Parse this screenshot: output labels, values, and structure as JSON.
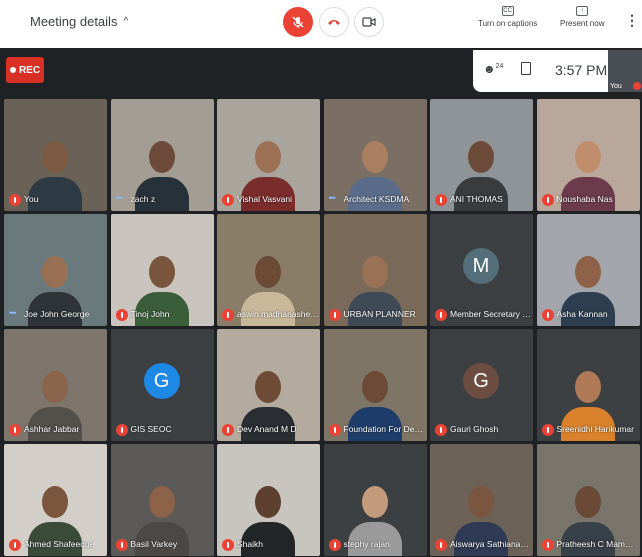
{
  "header": {
    "meeting_details_label": "Meeting details",
    "turn_on_captions_label": "Turn on captions",
    "present_now_label": "Present now",
    "more_label": "⋮",
    "captions_icon": "CC"
  },
  "status": {
    "rec_label": "REC",
    "participant_count": "24",
    "time": "3:57 PM",
    "self_label": "You"
  },
  "tiles": [
    {
      "name": "You",
      "state": "muted",
      "bg": "#6b6257",
      "face": "#7c5a44",
      "shirt": "#2e3a44"
    },
    {
      "name": "zach z",
      "state": "speaking",
      "bg": "#a49d93",
      "face": "#6d4b3b",
      "shirt": "#27313a"
    },
    {
      "name": "Vishal Vasvani",
      "state": "muted",
      "bg": "#a9a59d",
      "face": "#9c7155",
      "shirt": "#7a2c2c"
    },
    {
      "name": "Architect KSDMA",
      "state": "speaking",
      "bg": "#7b6f63",
      "face": "#a97f5f",
      "shirt": "#5b6b8a"
    },
    {
      "name": "ANI THOMAS",
      "state": "muted",
      "bg": "#8f9498",
      "face": "#6c4c38",
      "shirt": "#393b3d"
    },
    {
      "name": "Noushaba Nas",
      "state": "muted",
      "bg": "#b8a79a",
      "face": "#c08d6c",
      "shirt": "#6b3b4b"
    },
    {
      "name": "Joe John George",
      "state": "speaking",
      "bg": "#6a7a7c",
      "face": "#9a7054",
      "shirt": "#2e3438"
    },
    {
      "name": "Tinoj John",
      "state": "muted",
      "bg": "#c9c4bd",
      "face": "#7a553e",
      "shirt": "#3b5e3a"
    },
    {
      "name": "aswin madhanashekar",
      "state": "muted",
      "bg": "#8a7d68",
      "face": "#6b4a36",
      "shirt": "#c9b79a"
    },
    {
      "name": "URBAN PLANNER",
      "state": "muted",
      "bg": "#7a6a5a",
      "face": "#9b7256",
      "shirt": "#3f4a57"
    },
    {
      "name": "Member Secretary KSDMA",
      "state": "muted",
      "avatar": "M",
      "avatar_color": "#546e7a",
      "bg": "#3c4043"
    },
    {
      "name": "Asha Kannan",
      "state": "muted",
      "bg": "#a2a6ac",
      "face": "#8d6248",
      "shirt": "#2c3e50"
    },
    {
      "name": "Ashhar Jabbar",
      "state": "muted",
      "bg": "#7e766d",
      "face": "#8a644c",
      "shirt": "#53504c"
    },
    {
      "name": "GIS SEOC",
      "state": "muted",
      "avatar": "G",
      "avatar_color": "#1e88e5",
      "bg": "#3c4043"
    },
    {
      "name": "Dev Anand M D",
      "state": "muted",
      "bg": "#b4aa9d",
      "face": "#6d4b37",
      "shirt": "#2a2e33"
    },
    {
      "name": "Foundation For Development",
      "state": "muted",
      "bg": "#7f7566",
      "face": "#6b4a37",
      "shirt": "#1f3d6b"
    },
    {
      "name": "Gauri Ghosh",
      "state": "muted",
      "avatar": "G",
      "avatar_color": "#6d4c41",
      "bg": "#3c4043"
    },
    {
      "name": "Sreenidhi Harikumar",
      "state": "muted",
      "bg": "#3c4043",
      "face": "#b07a58",
      "shirt": "#d9822b"
    },
    {
      "name": "Ahmed Shafeeque",
      "state": "muted",
      "bg": "#d3cfc8",
      "face": "#7a563f",
      "shirt": "#3b4b3a"
    },
    {
      "name": "Basil Varkey",
      "state": "muted",
      "bg": "#5c5a58",
      "face": "#8c6248",
      "shirt": "#4b4845"
    },
    {
      "name": "Shaikh",
      "state": "muted",
      "bg": "#c8c4be",
      "face": "#5e4030",
      "shirt": "#222629"
    },
    {
      "name": "stephy rajan",
      "state": "muted",
      "bg": "#3c4043",
      "face": "#c39a7c",
      "shirt": "#9a9a9a"
    },
    {
      "name": "Aiswarya Sathianadhan",
      "state": "muted",
      "bg": "#6d6257",
      "face": "#7a553f",
      "shirt": "#2f3b54"
    },
    {
      "name": "Pratheesh C Mammen",
      "state": "muted",
      "bg": "#7a756b",
      "face": "#6a4a36",
      "shirt": "#384049"
    }
  ]
}
